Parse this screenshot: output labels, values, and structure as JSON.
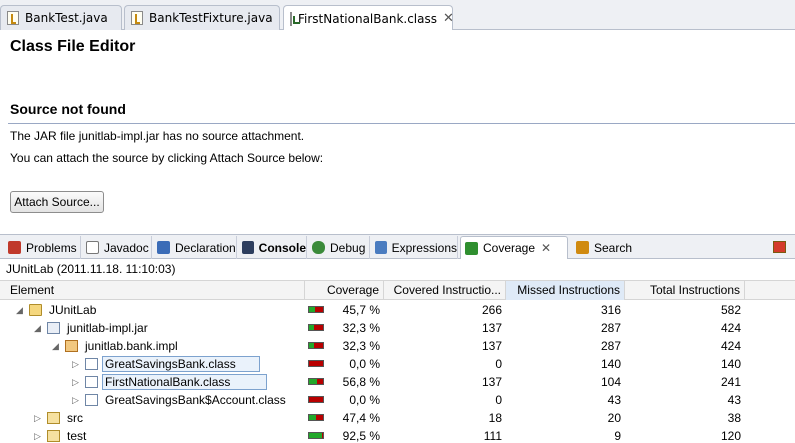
{
  "editor_tabs": [
    {
      "label": "BankTest.java",
      "icon": "java-file-icon",
      "active": false
    },
    {
      "label": "BankTestFixture.java",
      "icon": "java-file-icon",
      "active": false
    },
    {
      "label": "FirstNationalBank.class",
      "icon": "class-file-icon",
      "active": true,
      "close": "✕"
    }
  ],
  "editor": {
    "title": "Class File Editor",
    "section_title": "Source not found",
    "message_1": "The JAR file junitlab-impl.jar has no source attachment.",
    "message_2": "You can attach the source by clicking Attach Source below:",
    "attach_button": "Attach Source..."
  },
  "view_tabs": [
    {
      "label": "Problems",
      "icon": "problems-icon",
      "icon_color": "#c0392b"
    },
    {
      "label": "Javadoc",
      "icon": "at-icon",
      "icon_color": "#666666"
    },
    {
      "label": "Declaration",
      "icon": "declaration-icon",
      "icon_color": "#3b6cb7"
    },
    {
      "label": "Console",
      "icon": "console-icon",
      "icon_color": "#2d3e5e",
      "bold": true
    },
    {
      "label": "Debug",
      "icon": "debug-icon",
      "icon_color": "#3a8a3a"
    },
    {
      "label": "Expressions",
      "icon": "expressions-icon",
      "icon_color": "#4a7cc0"
    },
    {
      "label": "Coverage",
      "icon": "coverage-icon",
      "icon_color": "#2f8f2f",
      "active": true,
      "close": "✕"
    },
    {
      "label": "Search",
      "icon": "search-icon",
      "icon_color": "#d08a10"
    }
  ],
  "coverage": {
    "session": "JUnitLab (2011.11.18. 11:10:03)",
    "columns": [
      "Element",
      "Coverage",
      "Covered Instructio...",
      "Missed Instructions",
      "Total Instructions"
    ],
    "sorted_column": "Missed Instructions",
    "rows": [
      {
        "name": "JUnitLab",
        "icon": "project-icon",
        "twisty": "◢",
        "coverage": "45,7 %",
        "covered": "266",
        "missed": "316",
        "total": "582",
        "fraction": 0.457
      },
      {
        "name": "junitlab-impl.jar",
        "icon": "jar-icon",
        "twisty": "◢",
        "coverage": "32,3 %",
        "covered": "137",
        "missed": "287",
        "total": "424",
        "fraction": 0.323
      },
      {
        "name": "junitlab.bank.impl",
        "icon": "package-icon",
        "twisty": "◢",
        "coverage": "32,3 %",
        "covered": "137",
        "missed": "287",
        "total": "424",
        "fraction": 0.323
      },
      {
        "name": "GreatSavingsBank.class",
        "icon": "class-file-icon",
        "twisty": "▷",
        "coverage": "0,0 %",
        "covered": "0",
        "missed": "140",
        "total": "140",
        "fraction": 0.0,
        "highlight": true
      },
      {
        "name": "FirstNationalBank.class",
        "icon": "class-file-icon",
        "twisty": "▷",
        "coverage": "56,8 %",
        "covered": "137",
        "missed": "104",
        "total": "241",
        "fraction": 0.568,
        "highlight": true
      },
      {
        "name": "GreatSavingsBank$Account.class",
        "icon": "class-file-icon",
        "twisty": "▷",
        "coverage": "0,0 %",
        "covered": "0",
        "missed": "43",
        "total": "43",
        "fraction": 0.0
      },
      {
        "name": "src",
        "icon": "source-folder-icon",
        "twisty": "▷",
        "coverage": "47,4 %",
        "covered": "18",
        "missed": "20",
        "total": "38",
        "fraction": 0.474
      },
      {
        "name": "test",
        "icon": "source-folder-icon",
        "twisty": "▷",
        "coverage": "92,5 %",
        "covered": "111",
        "missed": "9",
        "total": "120",
        "fraction": 0.925
      }
    ]
  }
}
